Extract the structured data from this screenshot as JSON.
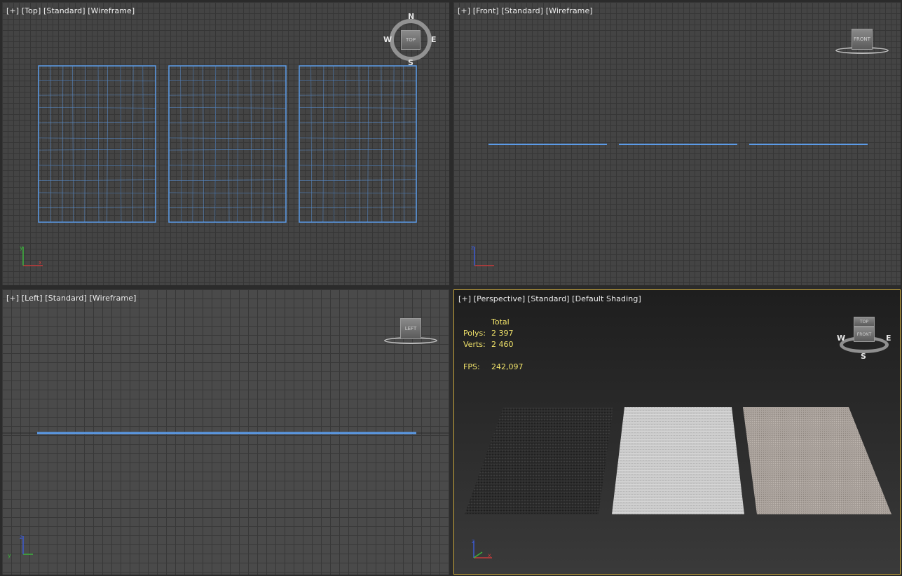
{
  "viewports": {
    "top": {
      "label_parts": [
        "[+]",
        "[Top]",
        "[Standard]",
        "[Wireframe]"
      ],
      "compass": {
        "n": "N",
        "s": "S",
        "e": "E",
        "w": "W",
        "cube": "TOP"
      }
    },
    "front": {
      "label_parts": [
        "[+]",
        "[Front]",
        "[Standard]",
        "[Wireframe]"
      ],
      "cube": "FRONT"
    },
    "left": {
      "label_parts": [
        "[+]",
        "[Left]",
        "[Standard]",
        "[Wireframe]"
      ],
      "cube": "LEFT"
    },
    "perspective": {
      "label_parts": [
        "[+]",
        "[Perspective]",
        "[Standard]",
        "[Default Shading]"
      ],
      "stats": {
        "header": "Total",
        "polys_label": "Polys:",
        "polys_value": "2 397",
        "verts_label": "Verts:",
        "verts_value": "2 460",
        "fps_label": "FPS:",
        "fps_value": "242,097"
      },
      "cube_top": "TOP",
      "cube_front": "FRONT",
      "compass": {
        "s": "S",
        "e": "E",
        "w": "W"
      }
    }
  },
  "colors": {
    "wire": "#5b9be8",
    "active_border": "#c6a53a",
    "stats_text": "#f1e36a",
    "axis_x": "#c83c3c",
    "axis_y": "#3cb43c",
    "axis_z": "#3c5ad2"
  },
  "axis_labels": {
    "x": "x",
    "y": "y",
    "z": "z"
  }
}
